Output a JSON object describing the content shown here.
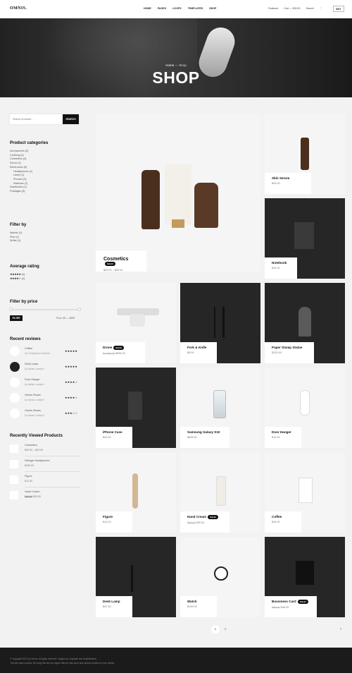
{
  "header": {
    "logo": "OMNIS.",
    "nav": [
      "HOME",
      "PAGES",
      "LOOPS",
      "TEMPLATES",
      "SHOP"
    ],
    "right": [
      "Features",
      "Cart — $30.00",
      "Search",
      "⋮"
    ],
    "buy": "BUY"
  },
  "hero": {
    "crumb_home": "Home",
    "crumb_sep": " — ",
    "crumb_current": "Shop",
    "title": "SHOP"
  },
  "sidebar": {
    "search": {
      "placeholder": "Search products…",
      "button": "SEARCH"
    },
    "categories": {
      "title": "Product categories",
      "items": [
        "Accessories (5)",
        "Clothing (3)",
        "Cosmetics (4)",
        "Decor (1)",
        "Electronics (5)",
        "Headphones (1)",
        "Lamp (1)",
        "Phones (3)",
        "Watches (1)",
        "Notebooks (1)",
        "Postages (3)"
      ]
    },
    "filter_by": {
      "title": "Filter by",
      "items": [
        "Marble (1)",
        "Pink (1)",
        "White (1)"
      ]
    },
    "rating": {
      "title": "Average rating",
      "items": [
        {
          "stars": "★★★★★",
          "count": "(4)"
        },
        {
          "stars": "★★★★☆",
          "count": "(4)"
        }
      ]
    },
    "price": {
      "title": "Filter by price",
      "button": "FILTER",
      "range": "Price: $0 — $999"
    },
    "reviews": {
      "title": "Recent reviews",
      "items": [
        {
          "product": "Coffee",
          "author": "by Christopher Andrews",
          "stars": "★★★★★"
        },
        {
          "product": "Desk Lamp",
          "author": "by Adrian Lampert",
          "stars": "★★★★★"
        },
        {
          "product": "Door Hanger",
          "author": "by Adrian Lampert",
          "stars": "★★★★☆"
        },
        {
          "product": "Omnis Shoes",
          "author": "by Adrian Lampert",
          "stars": "★★★★☆"
        },
        {
          "product": "Omnis Shoes",
          "author": "by Adrian Lampert",
          "stars": "★★★☆☆"
        }
      ]
    },
    "recent": {
      "title": "Recently Viewed Products",
      "items": [
        {
          "name": "Cosmetics",
          "price": "$29.00 – $39.00"
        },
        {
          "name": "Vintage Headphones",
          "price": "$299.00"
        },
        {
          "name": "Figure",
          "price": "$12.00"
        },
        {
          "name": "Hand Cream",
          "price_old": "$49.00",
          "price": "$39.00"
        }
      ]
    }
  },
  "products": [
    {
      "name": "Cosmetics",
      "price": "$29.00 – $39.00",
      "sale": "SALE!"
    },
    {
      "name": "Skin Serum",
      "price": "$29.00"
    },
    {
      "name": "Notebook",
      "price": "$12.00"
    },
    {
      "name": "Drone",
      "price_old": "$1,299.00",
      "price": "$999.00",
      "sale": "SALE!"
    },
    {
      "name": "Fork & Knife",
      "price": "$8.00"
    },
    {
      "name": "Paper Stamp Statue",
      "price": "$129.00"
    },
    {
      "name": "iPhone Case",
      "price": "$49.00"
    },
    {
      "name": "Samsung Galaxy S10",
      "price": "$899.00"
    },
    {
      "name": "Door Hanger",
      "price": "$10.00"
    },
    {
      "name": "Figure",
      "price": "$12.00"
    },
    {
      "name": "Hand Cream",
      "price_old": "$49.00",
      "price": "$39.00",
      "sale": "SALE!"
    },
    {
      "name": "Coffee",
      "price": "$39.00"
    },
    {
      "name": "Desk Lamp",
      "price": "$47.00"
    },
    {
      "name": "Watch",
      "price": "$199.00"
    },
    {
      "name": "Bussiness Card",
      "price_old": "$59.00",
      "price": "$48.00",
      "sale": "SALE!"
    }
  ],
  "pagination": {
    "current": "1",
    "next": "2",
    "arrow": "›"
  },
  "footer": {
    "line1": "© Copyright 2022 by Omnis. All rights reserved. Images by Unsplash and Graphikstock.",
    "line2": "This site uses cookies. By using this site you agree that we may store and access cookies on your device."
  }
}
